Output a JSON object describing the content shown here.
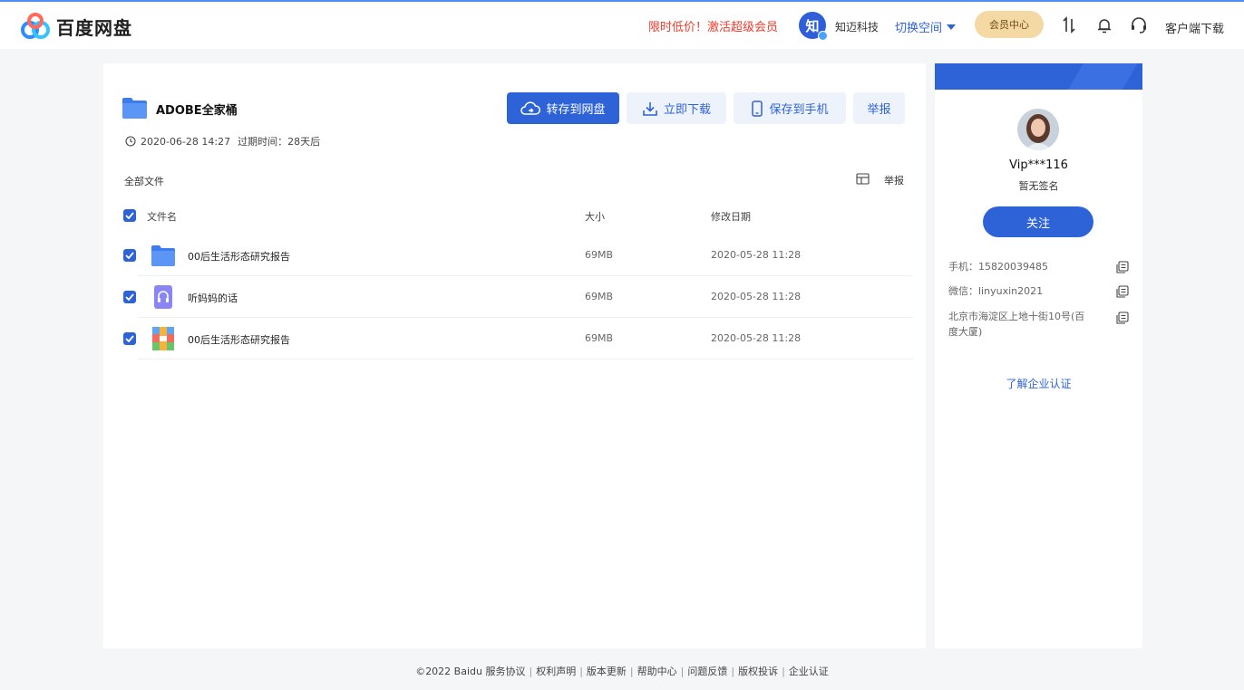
{
  "header": {
    "brand": "百度网盘",
    "promo": "限时低价！激活超级会员",
    "org_initial": "知",
    "org_name": "知迈科技",
    "switch_space": "切换空间",
    "vip_center": "会员中心",
    "client_download": "客户端下载"
  },
  "share": {
    "folder_title": "ADOBE全家桶",
    "created": "2020-06-28 14:27",
    "expire_label": "过期时间：28天后",
    "actions": {
      "save_to_disk": "转存到网盘",
      "download": "立即下载",
      "save_to_phone": "保存到手机",
      "report": "举报"
    }
  },
  "file_list": {
    "breadcrumb": "全部文件",
    "report": "举报",
    "columns": {
      "name": "文件名",
      "size": "大小",
      "modified": "修改日期"
    },
    "rows": [
      {
        "name": "00后生活形态研究报告",
        "size": "69MB",
        "modified": "2020-05-28 11:28",
        "type_icon": "folder-icon"
      },
      {
        "name": "听妈妈的话",
        "size": "69MB",
        "modified": "2020-05-28 11:28",
        "type_icon": "audio-file-icon"
      },
      {
        "name": "00后生活形态研究报告",
        "size": "69MB",
        "modified": "2020-05-28 11:28",
        "type_icon": "archive-file-icon"
      }
    ]
  },
  "profile": {
    "username": "Vip***116",
    "signature": "暂无签名",
    "follow": "关注",
    "phone": "手机：15820039485",
    "wechat": "微信：linyuxin2021",
    "address": "北京市海淀区上地十街10号(百度大厦)",
    "enterprise_link": "了解企业认证"
  },
  "footer": {
    "copyright": "©2022 Baidu",
    "links": [
      "服务协议",
      "权利声明",
      "版本更新",
      "帮助中心",
      "问题反馈",
      "版权投诉",
      "企业认证"
    ]
  },
  "colors": {
    "primary": "#2e63d8",
    "promo_red": "#f33a2b",
    "vip_gold": "#f5d9a5"
  }
}
